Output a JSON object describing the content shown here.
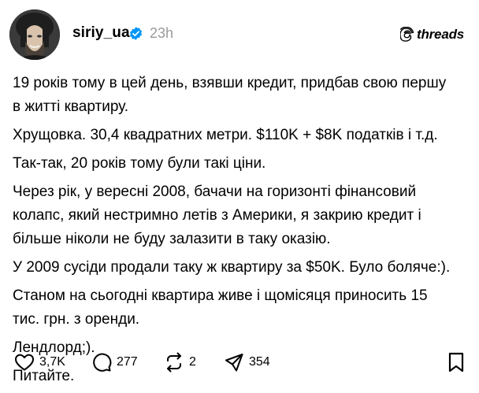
{
  "post": {
    "username": "siriy_ua",
    "time": "23h",
    "brand": "threads",
    "paragraphs": [
      [
        "19 років тому в цей день, взявши кредит, придбав свою першу",
        "в житті квартиру."
      ],
      [
        "Хрущовка. 30,4 квадратних метри. $110K + $8K податків і т.д."
      ],
      [
        "Так-так, 20 років тому були такі ціни."
      ],
      [
        "Через рік, у вересні 2008, бачачи на горизонті фінансовий",
        "колапс, який нестримно летів з Америки, я закрию кредит і",
        "більше ніколи не буду залазити в таку оказію."
      ],
      [
        "У 2009 сусіди продали таку ж квартиру за $50K. Було боляче:)."
      ],
      [
        "Станом на сьогодні квартира живе і щомісяця приносить 15",
        "тис. грн. з оренди."
      ],
      [
        "Лендлорд;)."
      ],
      [
        "Питайте."
      ]
    ],
    "actions": {
      "likes": "3,7K",
      "comments": "277",
      "reposts": "2",
      "shares": "354"
    }
  },
  "colors": {
    "text": "#000000",
    "muted": "#9a9a9a",
    "verified": "#0095f6",
    "background": "#ffffff"
  },
  "icons": [
    "verified-badge-icon",
    "threads-logo-icon",
    "heart-icon",
    "comment-icon",
    "repost-icon",
    "share-icon",
    "bookmark-icon"
  ]
}
